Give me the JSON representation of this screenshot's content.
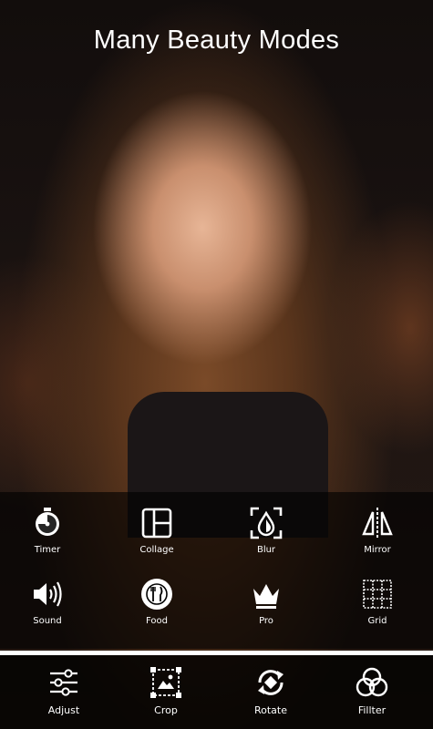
{
  "header": {
    "title": "Many Beauty Modes"
  },
  "tools": [
    {
      "label": "Timer",
      "icon": "timer-icon"
    },
    {
      "label": "Collage",
      "icon": "collage-icon"
    },
    {
      "label": "Blur",
      "icon": "blur-icon"
    },
    {
      "label": "Mirror",
      "icon": "mirror-icon"
    },
    {
      "label": "Sound",
      "icon": "sound-icon"
    },
    {
      "label": "Food",
      "icon": "food-icon"
    },
    {
      "label": "Pro",
      "icon": "crown-icon"
    },
    {
      "label": "Grid",
      "icon": "grid-icon"
    }
  ],
  "bottom_bar": [
    {
      "label": "Adjust",
      "icon": "sliders-icon"
    },
    {
      "label": "Crop",
      "icon": "crop-icon"
    },
    {
      "label": "Rotate",
      "icon": "rotate-icon"
    },
    {
      "label": "Fillter",
      "icon": "filter-icon"
    }
  ],
  "colors": {
    "panel": "#000000",
    "text": "#ffffff",
    "divider": "#ffffff"
  }
}
